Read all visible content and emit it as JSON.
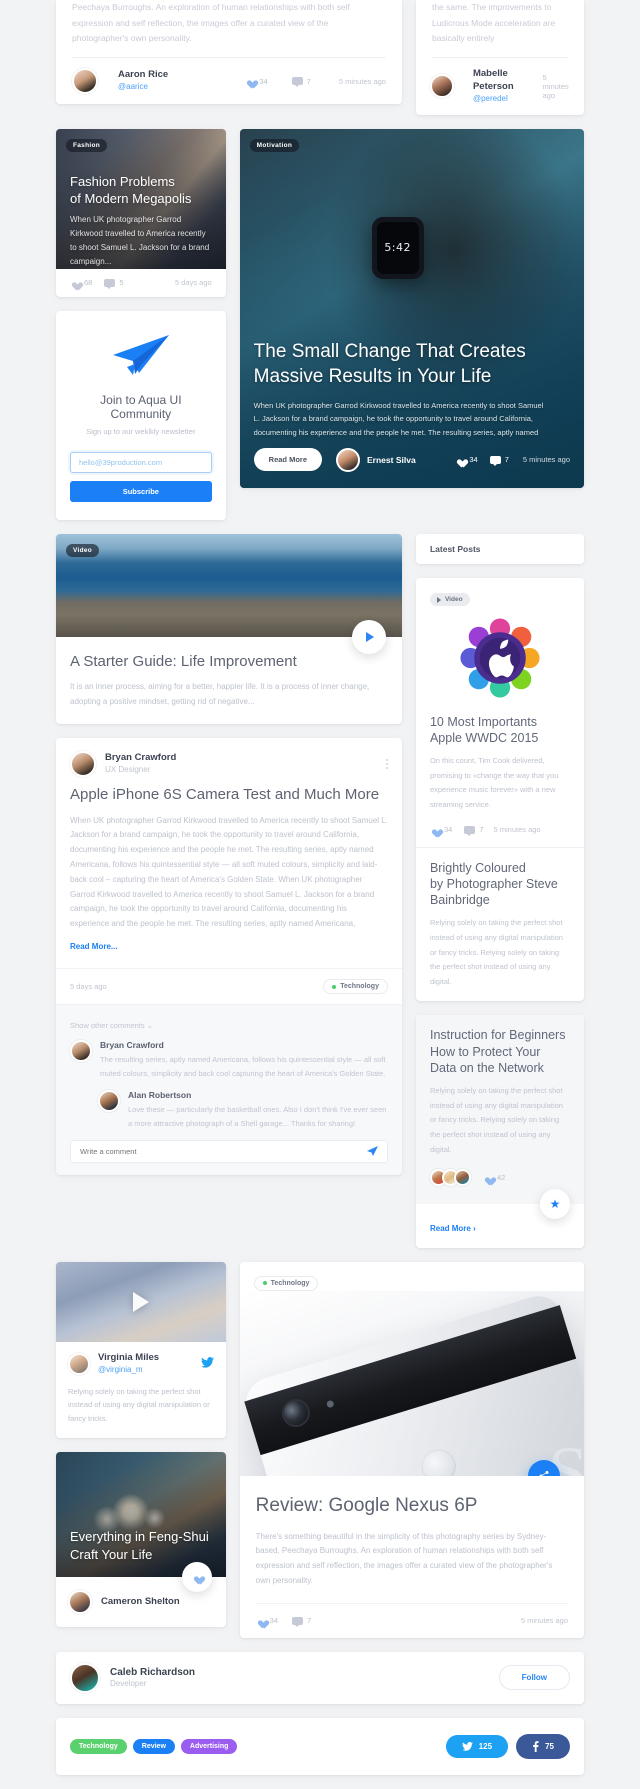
{
  "top_partial": {
    "left_text": "Peechaya Burroughs. An exploration of human relationships with both self expression and self reflection, the images offer a curated view of the photographer's own personality.",
    "left_author": {
      "name": "Aaron Rice",
      "handle": "@aarice"
    },
    "left_stats": {
      "likes": "34",
      "comments": "7",
      "time": "5 minutes ago"
    },
    "right_text": "the same. The improvements to Ludicrous Mode acceleration are basically entirely",
    "right_author": {
      "name": "Mabelle Peterson",
      "handle": "@peredel"
    },
    "right_time": "5 minutes ago"
  },
  "fashion_card": {
    "badge": "Fashion",
    "title_line1": "Fashion Problems",
    "title_line2": "of Modern Megapolis",
    "excerpt": "When UK photographer Garrod Kirkwood travelled to America recently to shoot Samuel L. Jackson for a brand campaign...",
    "likes": "68",
    "comments": "5",
    "time": "5 days ago"
  },
  "newsletter": {
    "icon": "paper-plane-icon",
    "title": "Join to Aqua UI Community",
    "subtitle": "Sign up to our weklkly newsletter",
    "email_value": "hello@39production.com",
    "email_placeholder": "hello@39production.com",
    "button": "Subscribe"
  },
  "hero": {
    "badge": "Motivation",
    "watch_time": "5:42",
    "title_line1": "The Small Change That Creates",
    "title_line2": "Massive Results in Your Life",
    "excerpt_l1": "When UK photographer Garrod Kirkwood travelled to America recently to shoot Samuel",
    "excerpt_l2": "L. Jackson for a brand campaign, he took the opportunity to travel around California,",
    "excerpt_l3": "documenting his experience and the people he met. The resulting series, aptly named",
    "read_more": "Read More",
    "author": "Ernest Silva",
    "likes": "34",
    "comments": "7",
    "time": "5 minutes ago"
  },
  "starter_guide": {
    "badge": "Video",
    "title": "A Starter Guide: Life Improvement",
    "excerpt": "It is an inner process, aiming for a better, happier life. It is a process of inner change, adopting a positive mindset, getting rid of negative..."
  },
  "article": {
    "author_name": "Bryan Crawford",
    "author_role": "UX Designer",
    "title": "Apple iPhone 6S Camera Test and Much More",
    "body": "When UK photographer Garrod Kirkwood travelled to America recently to shoot Samuel L. Jackson for a brand campaign, he took the opportunity to travel around California, documenting his experience and the people he met. The resulting series, aptly named Americana, follows his quintessential style — all soft muted colours, simplicity and laid-back cool – capturing the heart of America's Golden State. When UK photographer Garrod Kirkwood travelled to America recently to shoot Samuel L. Jackson for a brand campaign, he took the opportunity to travel around California, documenting his experience and the people he met. The resulting series, aptly named Americana,",
    "read_more": "Read More...",
    "time": "5 days ago",
    "tag": "Technology",
    "show_comments": "Show other comments ⌄",
    "comments": [
      {
        "name": "Bryan Crawford",
        "text": "The resulting series, aptly named Americana, follows his quintessential style — all soft muted colours, simplicity and back cool capturing the heart of America's Golden State."
      },
      {
        "name": "Alan Robertson",
        "text": "Love these — particularly the basketball ones. Also I don't think I've ever seen a more attractive photograph of a Shell garage... Thanks for sharing!"
      }
    ],
    "comment_placeholder": "Write a comment"
  },
  "sidebar": {
    "heading": "Latest Posts",
    "post1": {
      "badge": "Video",
      "title_line1": "10 Most Importants",
      "title_line2": "Apple WWDC 2015",
      "text": "On this count, Tim Cook delivered, promising to «change the way that you experience music forever» with a new streaming service.",
      "likes": "34",
      "comments": "7",
      "time": "5 minutes ago"
    },
    "post2": {
      "title_line1": "Brightly Coloured",
      "title_line2": "by Photographer Steve",
      "title_line3": "Bainbridge",
      "text": "Relying solely on taking the perfect shot instead of using any digital manipulation or fancy tricks. Relying solely on taking the perfect shot instead of using any digital."
    },
    "post3": {
      "title_line1": "Instruction for Beginners",
      "title_line2": "How to Protect Your",
      "title_line3": "Data on the Network",
      "text": "Relying solely on taking the perfect shot instead of using any digital manipulation or fancy tricks. Relying solely on taking the perfect shot instead of using any digital.",
      "likes": "42",
      "read_more": "Read More ›"
    }
  },
  "yarn_card": {
    "author_name": "Virginia Miles",
    "author_handle": "@virginia_m",
    "text": "Relying solely on taking the perfect shot instead of using any digital manipulation or fancy tricks."
  },
  "feng_card": {
    "title_line1": "Everything in Feng-Shui",
    "title_line2": "Craft Your Life",
    "author_name": "Cameron Shelton"
  },
  "nexus": {
    "tag": "Technology",
    "title": "Review: Google Nexus 6P",
    "excerpt": "There's something beautiful in the simplicity of this photography series by Sydney-based, Peechaya Burroughs. An exploration of human relationships with both self expression and self reflection, the images offer a curated view of the photographer's own personality.",
    "likes": "34",
    "comments": "7",
    "time": "5 minutes ago"
  },
  "follow_card": {
    "name": "Caleb Richardson",
    "role": "Developer",
    "button": "Follow"
  },
  "tags_footer": {
    "tags": [
      {
        "label": "Technology",
        "color": "#5bd06e"
      },
      {
        "label": "Review",
        "color": "#1b7ff5"
      },
      {
        "label": "Advertising",
        "color": "#9b5cf0"
      }
    ],
    "twitter": {
      "label": "125",
      "color": "#1da1f2"
    },
    "facebook": {
      "label": "75",
      "color": "#3b5998"
    }
  },
  "colors": {
    "accent": "#1b7ff5",
    "page_bg": "#f2f3f5",
    "text_dark": "#5b6170",
    "text_muted": "#bfc4ce"
  }
}
